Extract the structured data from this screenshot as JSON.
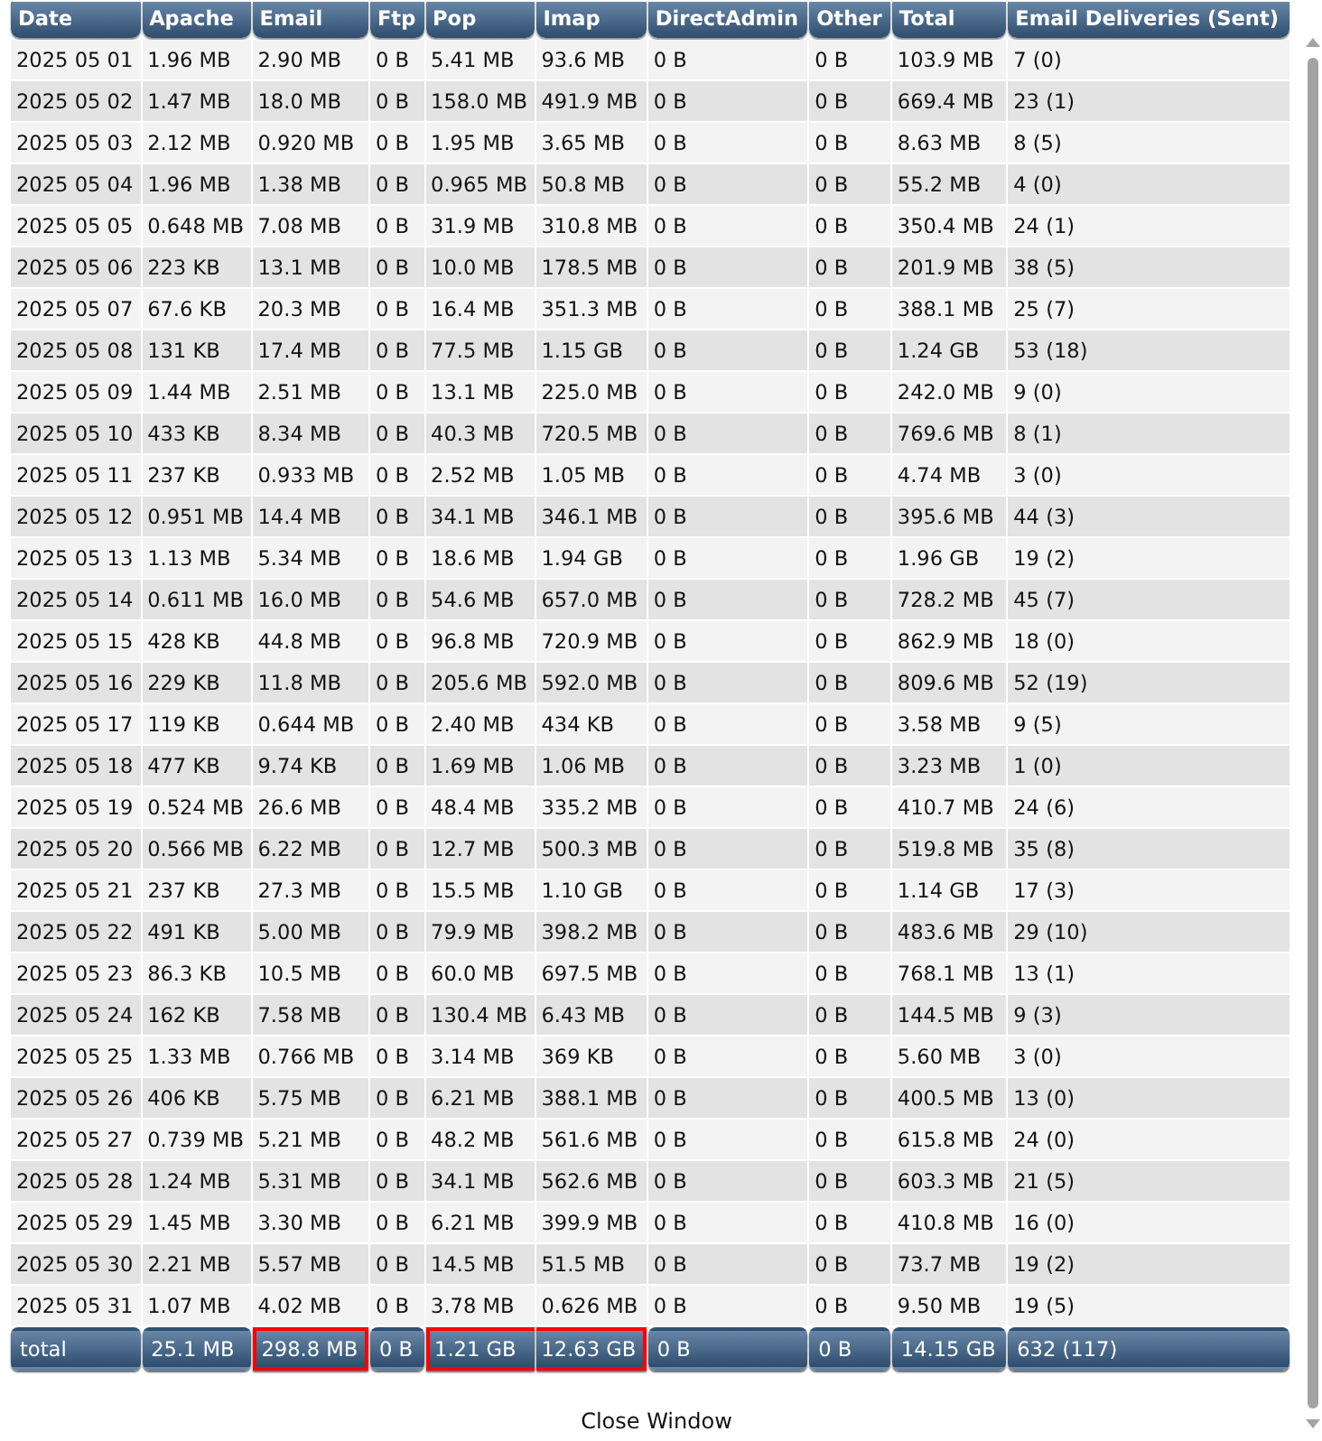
{
  "table": {
    "columns": [
      "Date",
      "Apache",
      "Email",
      "Ftp",
      "Pop",
      "Imap",
      "DirectAdmin",
      "Other",
      "Total",
      "Email Deliveries (Sent)"
    ],
    "rows": [
      [
        "2025 05 01",
        "1.96 MB",
        "2.90 MB",
        "0 B",
        "5.41 MB",
        "93.6 MB",
        "0 B",
        "0 B",
        "103.9 MB",
        "7 (0)"
      ],
      [
        "2025 05 02",
        "1.47 MB",
        "18.0 MB",
        "0 B",
        "158.0 MB",
        "491.9 MB",
        "0 B",
        "0 B",
        "669.4 MB",
        "23 (1)"
      ],
      [
        "2025 05 03",
        "2.12 MB",
        "0.920 MB",
        "0 B",
        "1.95 MB",
        "3.65 MB",
        "0 B",
        "0 B",
        "8.63 MB",
        "8 (5)"
      ],
      [
        "2025 05 04",
        "1.96 MB",
        "1.38 MB",
        "0 B",
        "0.965 MB",
        "50.8 MB",
        "0 B",
        "0 B",
        "55.2 MB",
        "4 (0)"
      ],
      [
        "2025 05 05",
        "0.648 MB",
        "7.08 MB",
        "0 B",
        "31.9 MB",
        "310.8 MB",
        "0 B",
        "0 B",
        "350.4 MB",
        "24 (1)"
      ],
      [
        "2025 05 06",
        "223 KB",
        "13.1 MB",
        "0 B",
        "10.0 MB",
        "178.5 MB",
        "0 B",
        "0 B",
        "201.9 MB",
        "38 (5)"
      ],
      [
        "2025 05 07",
        "67.6 KB",
        "20.3 MB",
        "0 B",
        "16.4 MB",
        "351.3 MB",
        "0 B",
        "0 B",
        "388.1 MB",
        "25 (7)"
      ],
      [
        "2025 05 08",
        "131 KB",
        "17.4 MB",
        "0 B",
        "77.5 MB",
        "1.15 GB",
        "0 B",
        "0 B",
        "1.24 GB",
        "53 (18)"
      ],
      [
        "2025 05 09",
        "1.44 MB",
        "2.51 MB",
        "0 B",
        "13.1 MB",
        "225.0 MB",
        "0 B",
        "0 B",
        "242.0 MB",
        "9 (0)"
      ],
      [
        "2025 05 10",
        "433 KB",
        "8.34 MB",
        "0 B",
        "40.3 MB",
        "720.5 MB",
        "0 B",
        "0 B",
        "769.6 MB",
        "8 (1)"
      ],
      [
        "2025 05 11",
        "237 KB",
        "0.933 MB",
        "0 B",
        "2.52 MB",
        "1.05 MB",
        "0 B",
        "0 B",
        "4.74 MB",
        "3 (0)"
      ],
      [
        "2025 05 12",
        "0.951 MB",
        "14.4 MB",
        "0 B",
        "34.1 MB",
        "346.1 MB",
        "0 B",
        "0 B",
        "395.6 MB",
        "44 (3)"
      ],
      [
        "2025 05 13",
        "1.13 MB",
        "5.34 MB",
        "0 B",
        "18.6 MB",
        "1.94 GB",
        "0 B",
        "0 B",
        "1.96 GB",
        "19 (2)"
      ],
      [
        "2025 05 14",
        "0.611 MB",
        "16.0 MB",
        "0 B",
        "54.6 MB",
        "657.0 MB",
        "0 B",
        "0 B",
        "728.2 MB",
        "45 (7)"
      ],
      [
        "2025 05 15",
        "428 KB",
        "44.8 MB",
        "0 B",
        "96.8 MB",
        "720.9 MB",
        "0 B",
        "0 B",
        "862.9 MB",
        "18 (0)"
      ],
      [
        "2025 05 16",
        "229 KB",
        "11.8 MB",
        "0 B",
        "205.6 MB",
        "592.0 MB",
        "0 B",
        "0 B",
        "809.6 MB",
        "52 (19)"
      ],
      [
        "2025 05 17",
        "119 KB",
        "0.644 MB",
        "0 B",
        "2.40 MB",
        "434 KB",
        "0 B",
        "0 B",
        "3.58 MB",
        "9 (5)"
      ],
      [
        "2025 05 18",
        "477 KB",
        "9.74 KB",
        "0 B",
        "1.69 MB",
        "1.06 MB",
        "0 B",
        "0 B",
        "3.23 MB",
        "1 (0)"
      ],
      [
        "2025 05 19",
        "0.524 MB",
        "26.6 MB",
        "0 B",
        "48.4 MB",
        "335.2 MB",
        "0 B",
        "0 B",
        "410.7 MB",
        "24 (6)"
      ],
      [
        "2025 05 20",
        "0.566 MB",
        "6.22 MB",
        "0 B",
        "12.7 MB",
        "500.3 MB",
        "0 B",
        "0 B",
        "519.8 MB",
        "35 (8)"
      ],
      [
        "2025 05 21",
        "237 KB",
        "27.3 MB",
        "0 B",
        "15.5 MB",
        "1.10 GB",
        "0 B",
        "0 B",
        "1.14 GB",
        "17 (3)"
      ],
      [
        "2025 05 22",
        "491 KB",
        "5.00 MB",
        "0 B",
        "79.9 MB",
        "398.2 MB",
        "0 B",
        "0 B",
        "483.6 MB",
        "29 (10)"
      ],
      [
        "2025 05 23",
        "86.3 KB",
        "10.5 MB",
        "0 B",
        "60.0 MB",
        "697.5 MB",
        "0 B",
        "0 B",
        "768.1 MB",
        "13 (1)"
      ],
      [
        "2025 05 24",
        "162 KB",
        "7.58 MB",
        "0 B",
        "130.4 MB",
        "6.43 MB",
        "0 B",
        "0 B",
        "144.5 MB",
        "9 (3)"
      ],
      [
        "2025 05 25",
        "1.33 MB",
        "0.766 MB",
        "0 B",
        "3.14 MB",
        "369 KB",
        "0 B",
        "0 B",
        "5.60 MB",
        "3 (0)"
      ],
      [
        "2025 05 26",
        "406 KB",
        "5.75 MB",
        "0 B",
        "6.21 MB",
        "388.1 MB",
        "0 B",
        "0 B",
        "400.5 MB",
        "13 (0)"
      ],
      [
        "2025 05 27",
        "0.739 MB",
        "5.21 MB",
        "0 B",
        "48.2 MB",
        "561.6 MB",
        "0 B",
        "0 B",
        "615.8 MB",
        "24 (0)"
      ],
      [
        "2025 05 28",
        "1.24 MB",
        "5.31 MB",
        "0 B",
        "34.1 MB",
        "562.6 MB",
        "0 B",
        "0 B",
        "603.3 MB",
        "21 (5)"
      ],
      [
        "2025 05 29",
        "1.45 MB",
        "3.30 MB",
        "0 B",
        "6.21 MB",
        "399.9 MB",
        "0 B",
        "0 B",
        "410.8 MB",
        "16 (0)"
      ],
      [
        "2025 05 30",
        "2.21 MB",
        "5.57 MB",
        "0 B",
        "14.5 MB",
        "51.5 MB",
        "0 B",
        "0 B",
        "73.7 MB",
        "19 (2)"
      ],
      [
        "2025 05 31",
        "1.07 MB",
        "4.02 MB",
        "0 B",
        "3.78 MB",
        "0.626 MB",
        "0 B",
        "0 B",
        "9.50 MB",
        "19 (5)"
      ]
    ],
    "total": [
      {
        "text": "total",
        "highlighted": false
      },
      {
        "text": "25.1 MB",
        "highlighted": false
      },
      {
        "text": "298.8 MB",
        "highlighted": true
      },
      {
        "text": "0 B",
        "highlighted": false
      },
      {
        "text": "1.21 GB",
        "highlighted": true
      },
      {
        "text": "12.63 GB",
        "highlighted": true
      },
      {
        "text": "0 B",
        "highlighted": false
      },
      {
        "text": "0 B",
        "highlighted": false
      },
      {
        "text": "14.15 GB",
        "highlighted": false
      },
      {
        "text": "632 (117)",
        "highlighted": false
      }
    ]
  },
  "close_link": "Close Window"
}
